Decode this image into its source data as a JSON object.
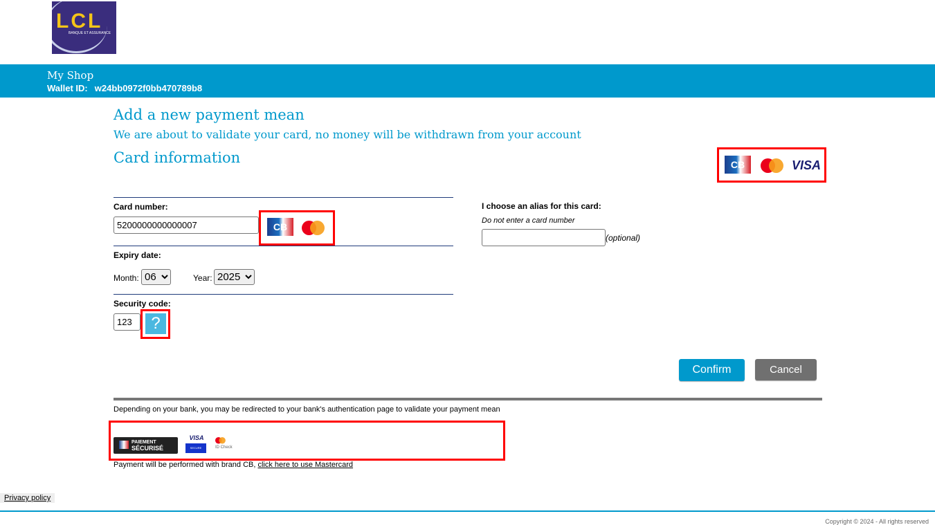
{
  "header": {
    "logo_text": "LCL",
    "logo_subtext": "BANQUE ET ASSURANCE",
    "shop_name": "My Shop",
    "wallet_label": "Wallet ID:",
    "wallet_id": "w24bb0972f0bb470789b8"
  },
  "page": {
    "title": "Add a new payment mean",
    "subtitle": "We are about to validate your card, no money will be withdrawn from your account",
    "section_title": "Card information"
  },
  "brands": {
    "cb": "CB",
    "visa": "VISA"
  },
  "form": {
    "card_number_label": "Card number:",
    "card_number_value": "5200000000000007",
    "expiry_label": "Expiry date:",
    "month_label": "Month:",
    "month_value": "06",
    "year_label": "Year:",
    "year_value": "2025",
    "security_label": "Security code:",
    "security_value": "123",
    "help_glyph": "?",
    "alias_label": "I choose an alias for this card:",
    "alias_hint": "Do not enter a card number",
    "alias_value": "",
    "alias_optional": "(optional)"
  },
  "actions": {
    "confirm": "Confirm",
    "cancel": "Cancel"
  },
  "footer": {
    "notice": "Depending on your bank, you may be redirected to your bank's authentication page to validate your payment mean",
    "badge_paiement": "PAIEMENT",
    "badge_securise": "SÉCURISÉ",
    "visa_secure": "SECURE",
    "id_check": "ID Check",
    "brand_text": "Payment will be performed with brand CB, ",
    "brand_link": "click here to use Mastercard",
    "privacy": "Privacy policy",
    "copyright": "Copyright © 2024 - All rights reserved"
  },
  "colors": {
    "primary": "#0099cc",
    "cancel": "#707070",
    "highlight": "#ff0000"
  }
}
